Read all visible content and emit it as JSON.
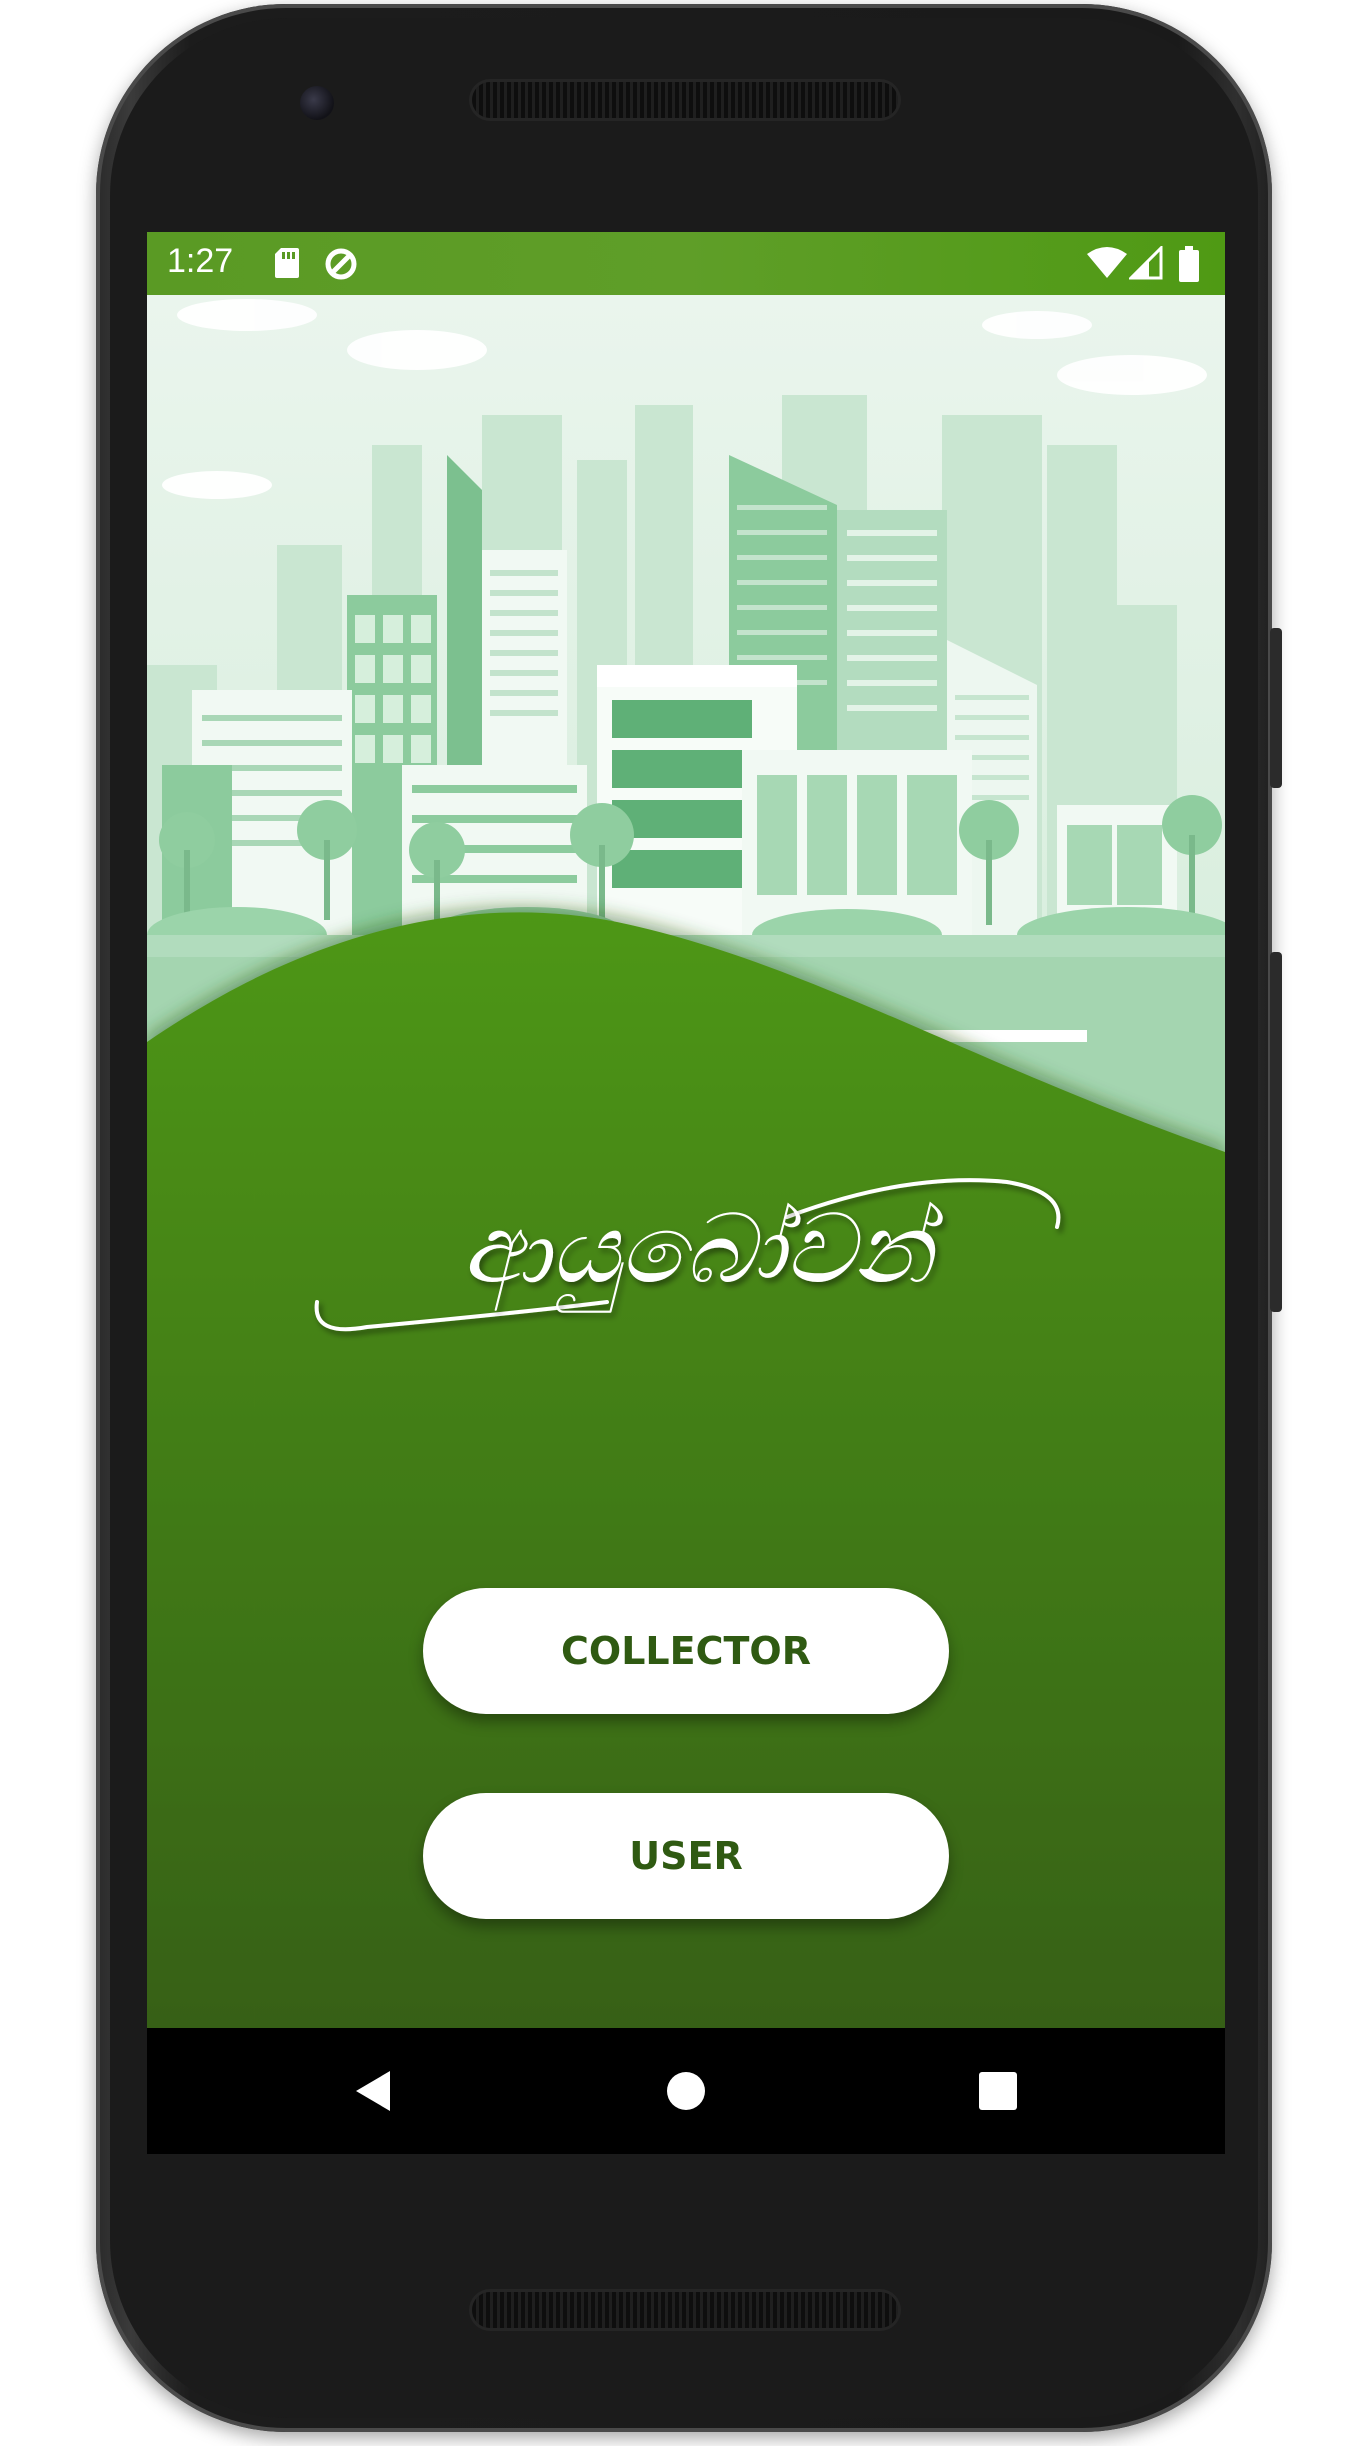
{
  "device": {
    "name": "phone-frame"
  },
  "status_bar": {
    "time": "1:27",
    "icons": [
      "sd-card-icon",
      "sync-icon",
      "wifi-icon",
      "signal-icon",
      "battery-icon"
    ]
  },
  "app": {
    "logo_text": "ආයුබෝවන්",
    "buttons": {
      "collector_label": "COLLECTOR",
      "user_label": "USER"
    }
  },
  "nav_bar": {
    "icons": [
      "back-icon",
      "home-icon",
      "recents-icon"
    ]
  },
  "colors": {
    "status_bar": "#5a9a24",
    "hill_top": "#4e9713",
    "hill_bottom": "#365e18",
    "button_text": "#2f5a12",
    "sky": "#e6f3ea"
  }
}
